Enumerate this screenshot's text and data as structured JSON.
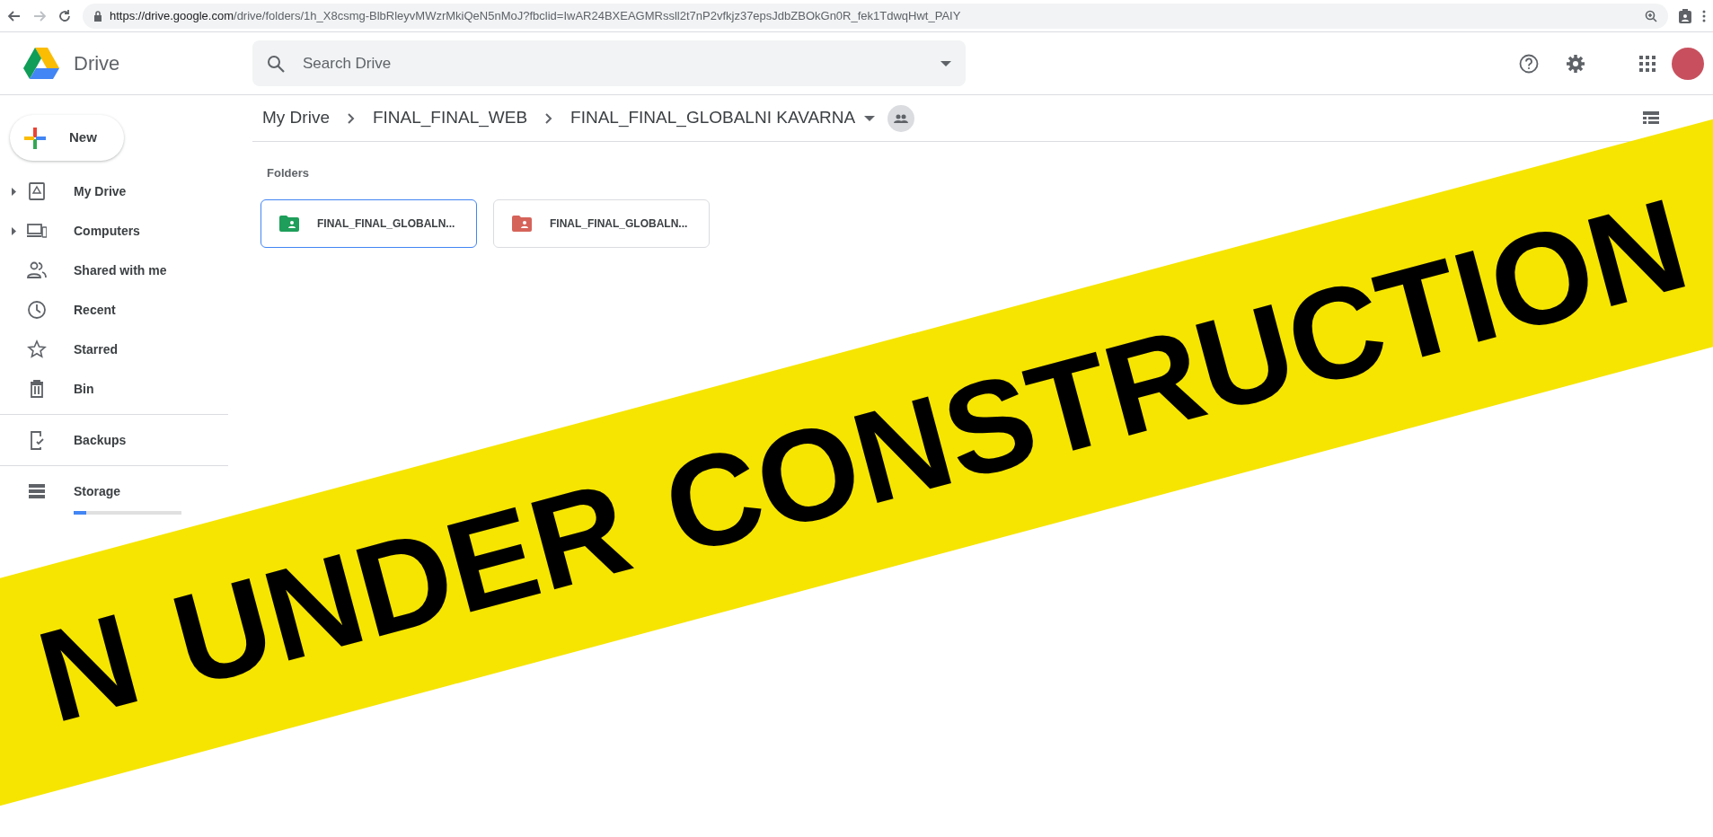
{
  "browser": {
    "url_host": "https://drive.google.com",
    "url_path": "/drive/folders/1h_X8csmg-BlbRleyvMWzrMkiQeN5nMoJ?fbclid=IwAR24BXEAGMRssll2t7nP2vfkjz37epsJdbZBOkGn0R_fek1TdwqHwt_PAIY"
  },
  "header": {
    "app_name": "Drive",
    "search": {
      "placeholder": "Search Drive"
    }
  },
  "new_button": "New",
  "sidebar": {
    "sections": [
      [
        {
          "label": "My Drive",
          "expandable": true,
          "selected": false
        },
        {
          "label": "Computers",
          "expandable": true,
          "selected": false
        },
        {
          "label": "Shared with me",
          "expandable": false,
          "selected": false
        },
        {
          "label": "Recent",
          "expandable": false,
          "selected": false
        },
        {
          "label": "Starred",
          "expandable": false,
          "selected": false
        },
        {
          "label": "Bin",
          "expandable": false,
          "selected": false
        }
      ],
      [
        {
          "label": "Backups",
          "expandable": false,
          "selected": false
        }
      ],
      [
        {
          "label": "Storage",
          "expandable": false,
          "selected": false
        }
      ]
    ],
    "storage": {
      "level": 0.12
    }
  },
  "breadcrumbs": [
    "My Drive",
    "FINAL_FINAL_WEB",
    "FINAL_FINAL_GLOBALNI KAVARNA"
  ],
  "folders_heading": "Folders",
  "folders": [
    {
      "name": "FINAL_FINAL_GLOBALN...",
      "color": "#1e9e5a",
      "selected": true
    },
    {
      "name": "FINAL_FINAL_GLOBALN...",
      "color": "#d5635a",
      "selected": false
    }
  ],
  "tape": {
    "texts": [
      "N",
      "UNDER",
      "CONSTRUCTION"
    ]
  }
}
